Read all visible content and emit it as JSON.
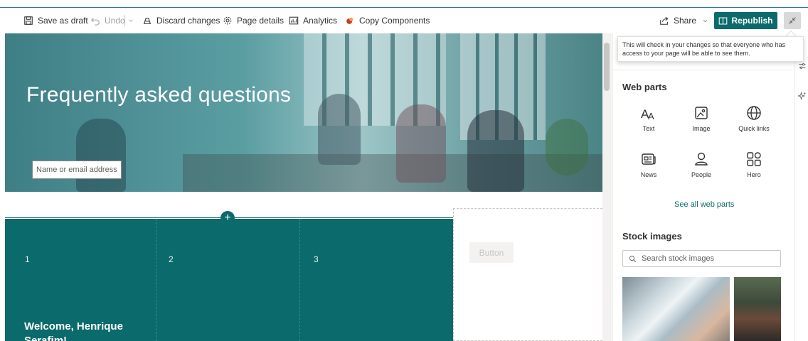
{
  "toolbar": {
    "save_draft": "Save as draft",
    "undo": "Undo",
    "discard": "Discard changes",
    "page_details": "Page details",
    "analytics": "Analytics",
    "copy_components": "Copy Components",
    "share": "Share",
    "republish": "Republish"
  },
  "hero": {
    "title": "Frequently asked questions",
    "input_placeholder": "Name or email address"
  },
  "section": {
    "columns": [
      "1",
      "2",
      "3"
    ],
    "welcome": "Welcome, Henrique Serafim!",
    "button_label": "Button"
  },
  "tooltip": {
    "text": "This will check in your changes so that everyone who has access to your page will be able to see them."
  },
  "web_parts": {
    "heading": "Web parts",
    "items": [
      {
        "label": "Text",
        "icon": "text-icon"
      },
      {
        "label": "Image",
        "icon": "image-icon"
      },
      {
        "label": "Quick links",
        "icon": "globe-icon"
      },
      {
        "label": "News",
        "icon": "news-icon"
      },
      {
        "label": "People",
        "icon": "person-icon"
      },
      {
        "label": "Hero",
        "icon": "hero-icon"
      }
    ],
    "see_all": "See all web parts"
  },
  "stock_images": {
    "heading": "Stock images",
    "search_placeholder": "Search stock images"
  },
  "colors": {
    "accent": "#0b6a6b",
    "link": "#0b6a6b"
  }
}
